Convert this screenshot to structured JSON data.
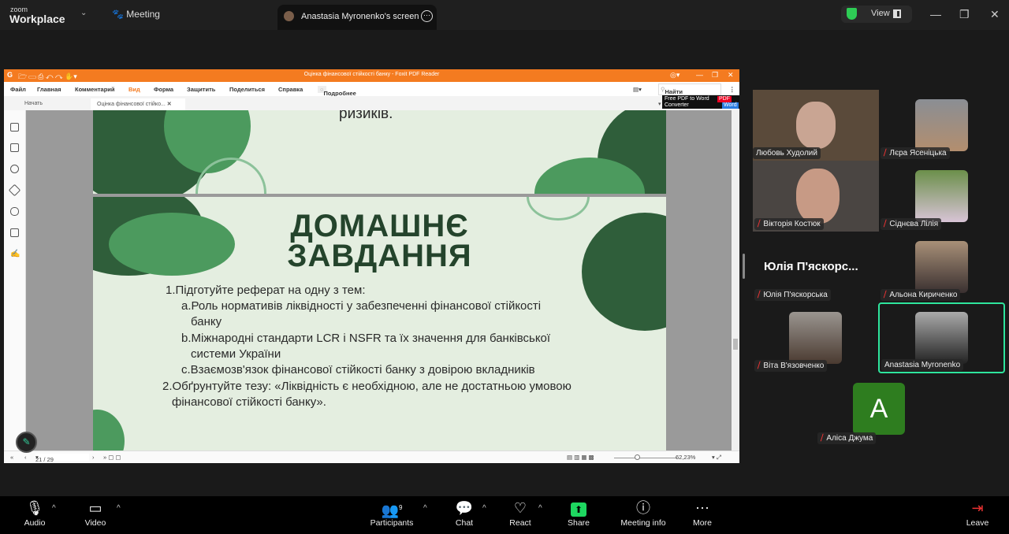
{
  "zoom": {
    "logo_small": "zoom",
    "logo_big": "Workplace",
    "meeting_label": "Meeting",
    "share_tab": "Anastasia Myronenko's screen",
    "view_label": "View"
  },
  "foxit": {
    "title": "Оцінка фінансової стійкості банку - Foxit PDF Reader",
    "menu": [
      "Файл",
      "Главная",
      "Комментарий",
      "Вид",
      "Форма",
      "Защитить",
      "Поделиться",
      "Справка"
    ],
    "tell_me": "Подробнее",
    "search_placeholder": "Найти",
    "tabs": [
      "Начать",
      "Оцінка фінансової стійко..."
    ],
    "converter": {
      "line1": "Free PDF to Word",
      "line2": "Converter",
      "badge1": "PDF",
      "badge2": "Word"
    },
    "page_indicator": "21 / 29",
    "zoom_level": "62,23%"
  },
  "slide_prev": {
    "text": "ризиків."
  },
  "slide": {
    "title_line1": "ДОМАШНЄ",
    "title_line2": "ЗАВДАННЯ",
    "lines": [
      "1.Підготуйте реферат на одну з тем:",
      "a.Роль нормативів ліквідності у забезпеченні фінансової стійкості",
      "банку",
      "b.Міжнародні стандарти LCR і NSFR та їх значення для банківської",
      "системи України",
      "c.Взаємозв'язок фінансової стійкості банку з довірою вкладників",
      "2.Обґрунтуйте тезу: «Ліквідність є необхідною, але не достатньою умовою",
      "фінансової стійкості банку»."
    ]
  },
  "participants": [
    {
      "name": "Любовь Худолий",
      "muted": false
    },
    {
      "name": "Лєра Ясеніцька",
      "muted": true
    },
    {
      "name": "Вікторія Костюк",
      "muted": true
    },
    {
      "name": "Сіднєва Лілія",
      "muted": true
    },
    {
      "name": "Юлія П'яскорська",
      "muted": true,
      "big_label": "Юлія П'яскорс..."
    },
    {
      "name": "Альона Кириченко",
      "muted": true
    },
    {
      "name": "Віта В'язовченко",
      "muted": true
    },
    {
      "name": "Anastasia Myronenko",
      "muted": false,
      "active": true
    },
    {
      "name": "Аліса Джума",
      "muted": true,
      "initial": "A"
    }
  ],
  "toolbar": {
    "audio": "Audio",
    "video": "Video",
    "participants": "Participants",
    "participants_count": "9",
    "chat": "Chat",
    "react": "React",
    "share": "Share",
    "meeting_info": "Meeting info",
    "more": "More",
    "leave": "Leave"
  },
  "colors": {
    "foxit_orange": "#f47b20",
    "active_border": "#2ee59d",
    "avatar_green": "#2e7d1f",
    "slide_bg": "#e4eee0",
    "slide_title": "#24442c"
  }
}
